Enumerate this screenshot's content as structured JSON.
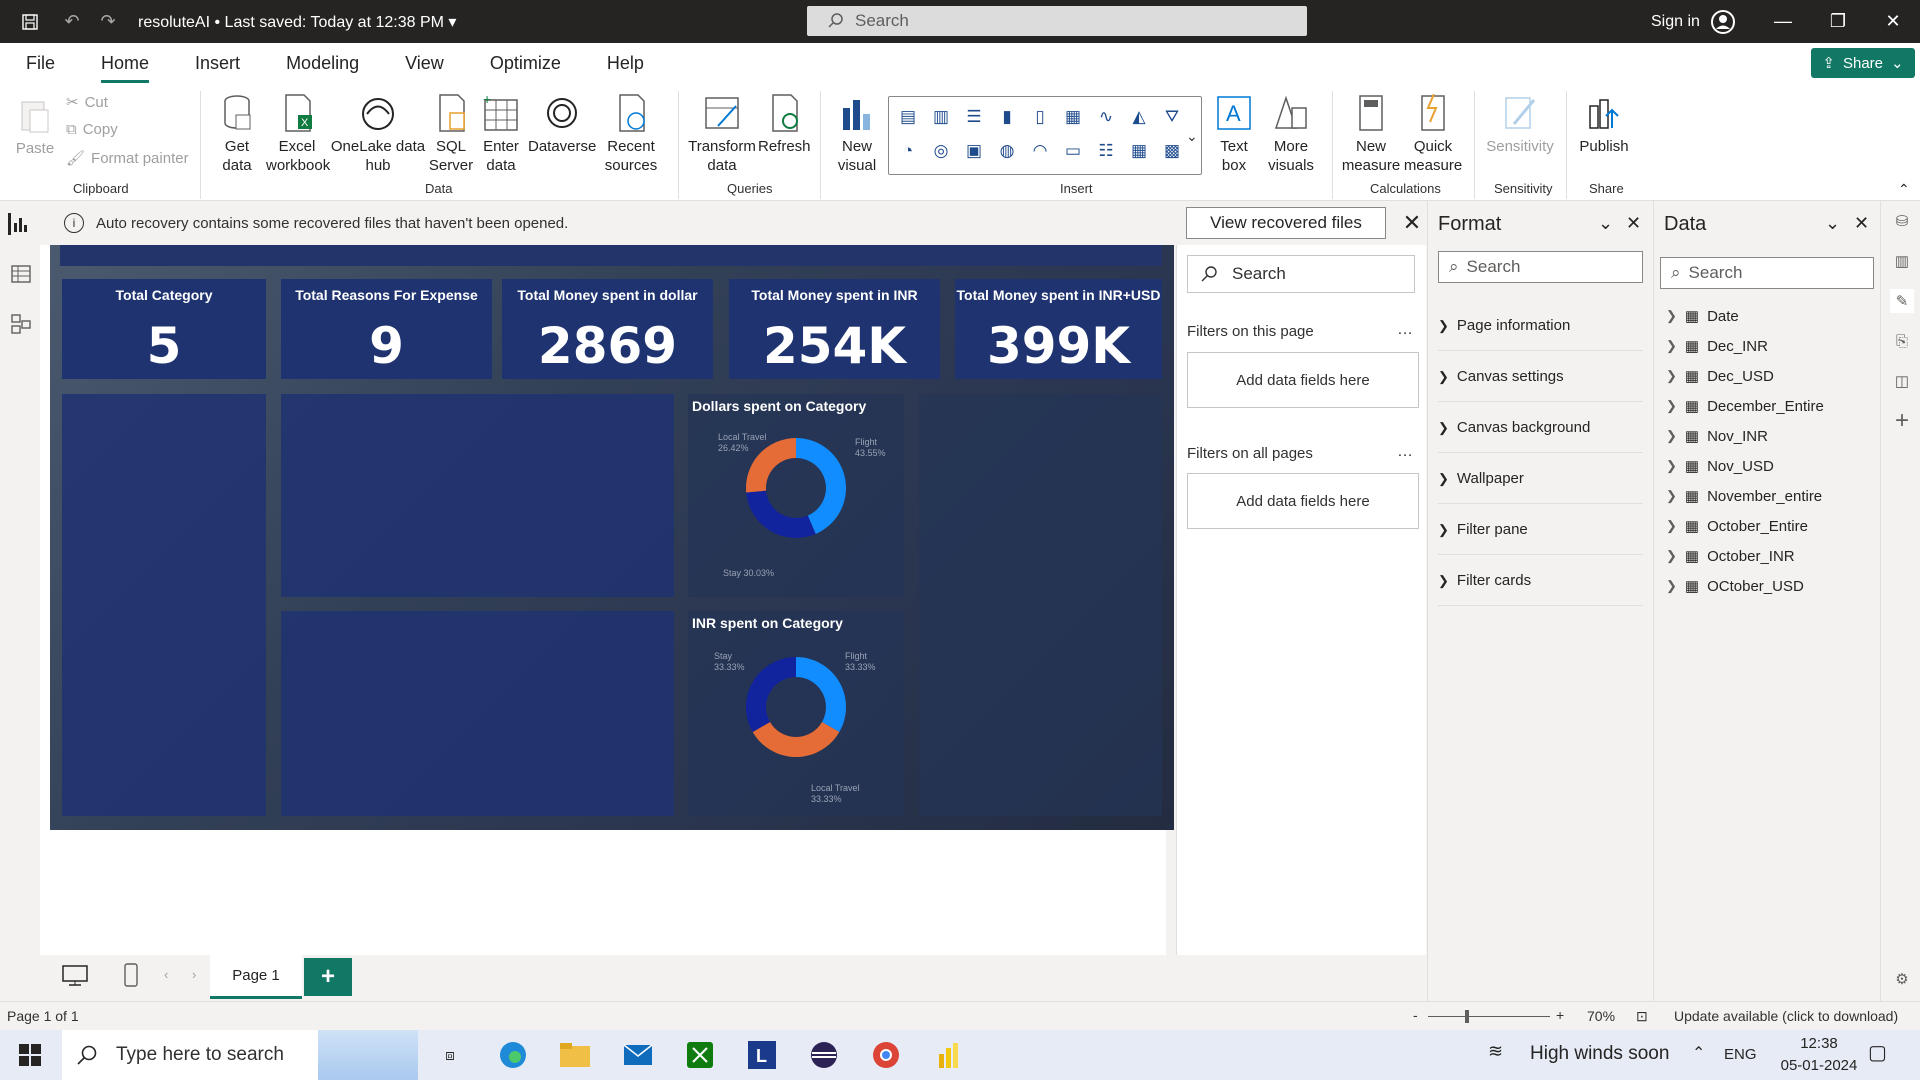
{
  "titlebar": {
    "filename": "resoluteAI",
    "saved": "Last saved: Today at 12:38 PM",
    "search_placeholder": "Search",
    "signin": "Sign in"
  },
  "menu": {
    "items": [
      "File",
      "Home",
      "Insert",
      "Modeling",
      "View",
      "Optimize",
      "Help"
    ],
    "share": "Share"
  },
  "ribbon": {
    "paste": "Paste",
    "cut": "Cut",
    "copy": "Copy",
    "format_painter": "Format painter",
    "clipboard": "Clipboard",
    "get_data": "Get data",
    "excel": "Excel workbook",
    "onelake": "OneLake data hub",
    "sql": "SQL Server",
    "enter_data": "Enter data",
    "dataverse": "Dataverse",
    "recent": "Recent sources",
    "data_group": "Data",
    "transform": "Transform data",
    "refresh": "Refresh",
    "queries": "Queries",
    "new_visual": "New visual",
    "text_box": "Text box",
    "more_visuals": "More visuals",
    "insert_group": "Insert",
    "new_measure": "New measure",
    "quick_measure": "Quick measure",
    "calculations": "Calculations",
    "sensitivity_btn": "Sensitivity",
    "sensitivity_group": "Sensitivity",
    "publish": "Publish",
    "share_group": "Share"
  },
  "notification": {
    "text": "Auto recovery contains some recovered files that haven't been opened.",
    "button": "View recovered files"
  },
  "report": {
    "kpis": [
      {
        "title": "Total Category",
        "value": "5"
      },
      {
        "title": "Total Reasons For Expense",
        "value": "9"
      },
      {
        "title": "Total Money spent in dollar",
        "value": "2869"
      },
      {
        "title": "Total Money spent in INR",
        "value": "254K"
      },
      {
        "title": "Total Money spent in INR+USD",
        "value": "399K"
      }
    ],
    "donut1": {
      "title": "Dollars spent on Category",
      "l1": "Local Travel",
      "v1": "26.42%",
      "l2": "Flight",
      "v2": "43.55%",
      "l3": "Stay 30.03%"
    },
    "donut2": {
      "title": "INR spent on Category",
      "l1": "Stay",
      "v1": "33.33%",
      "l2": "Flight",
      "v2": "33.33%",
      "l3": "Local Travel",
      "v3": "33.33%"
    }
  },
  "chart_data": [
    {
      "type": "pie",
      "title": "Dollars spent on Category",
      "categories": [
        "Flight",
        "Stay",
        "Local Travel"
      ],
      "values": [
        43.55,
        30.03,
        26.42
      ],
      "colors": [
        "#118DFF",
        "#12239E",
        "#E66C37"
      ]
    },
    {
      "type": "pie",
      "title": "INR spent on Category",
      "categories": [
        "Flight",
        "Local Travel",
        "Stay"
      ],
      "values": [
        33.33,
        33.33,
        33.33
      ],
      "colors": [
        "#118DFF",
        "#E66C37",
        "#12239E"
      ]
    }
  ],
  "filters": {
    "search": "Search",
    "on_page": "Filters on this page",
    "add_here": "Add data fields here",
    "all_pages": "Filters on all pages",
    "add_here2": "Add data fields here"
  },
  "format": {
    "title": "Format",
    "search": "Search",
    "sections": [
      "Page information",
      "Canvas settings",
      "Canvas background",
      "Wallpaper",
      "Filter pane",
      "Filter cards"
    ]
  },
  "data": {
    "title": "Data",
    "search": "Search",
    "tables": [
      "Date",
      "Dec_INR",
      "Dec_USD",
      "December_Entire",
      "Nov_INR",
      "Nov_USD",
      "November_entire",
      "October_Entire",
      "October_INR",
      "OCtober_USD"
    ]
  },
  "pages": {
    "tab": "Page 1"
  },
  "status": {
    "page": "Page 1 of 1",
    "zoom": "70%",
    "update": "Update available (click to download)",
    "minus": "-",
    "plus": "+"
  },
  "taskbar": {
    "search": "Type here to search",
    "weather": "High winds soon",
    "lang": "ENG",
    "time": "12:38",
    "date": "05-01-2024"
  }
}
